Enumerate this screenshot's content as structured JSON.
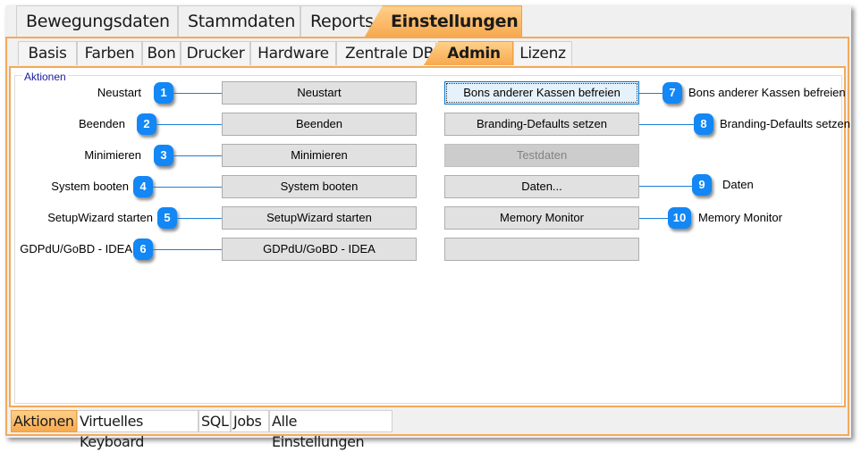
{
  "top_tabs": [
    {
      "label": "Bewegungsdaten",
      "active": false
    },
    {
      "label": "Stammdaten",
      "active": false
    },
    {
      "label": "Reports",
      "active": false
    },
    {
      "label": "Einstellungen",
      "active": true
    }
  ],
  "sub_tabs": [
    {
      "label": "Basis",
      "active": false
    },
    {
      "label": "Farben",
      "active": false
    },
    {
      "label": "Bon",
      "active": false
    },
    {
      "label": "Drucker",
      "active": false
    },
    {
      "label": "Hardware",
      "active": false
    },
    {
      "label": "Zentrale DB",
      "active": false
    },
    {
      "label": "Admin",
      "active": true
    },
    {
      "label": "Lizenz",
      "active": false
    }
  ],
  "group": {
    "title": "Aktionen"
  },
  "left_buttons": [
    {
      "label": "Neustart",
      "callout": "1",
      "callout_label": "Neustart"
    },
    {
      "label": "Beenden",
      "callout": "2",
      "callout_label": "Beenden"
    },
    {
      "label": "Minimieren",
      "callout": "3",
      "callout_label": "Minimieren"
    },
    {
      "label": "System booten",
      "callout": "4",
      "callout_label": "System booten"
    },
    {
      "label": "SetupWizard starten",
      "callout": "5",
      "callout_label": "SetupWizard starten"
    },
    {
      "label": "GDPdU/GoBD - IDEA",
      "callout": "6",
      "callout_label": "GDPdU/GoBD - IDEA"
    }
  ],
  "right_buttons": [
    {
      "label": "Bons anderer Kassen befreien",
      "callout": "7",
      "callout_label": "Bons anderer Kassen befreien",
      "state": "focused"
    },
    {
      "label": "Branding-Defaults setzen",
      "callout": "8",
      "callout_label": "Branding-Defaults setzen",
      "state": "normal"
    },
    {
      "label": "Testdaten",
      "callout": null,
      "callout_label": null,
      "state": "disabled"
    },
    {
      "label": "Daten...",
      "callout": "9",
      "callout_label": "Daten",
      "state": "normal"
    },
    {
      "label": "Memory Monitor",
      "callout": "10",
      "callout_label": "Memory Monitor",
      "state": "normal"
    },
    {
      "label": "",
      "callout": null,
      "callout_label": null,
      "state": "normal"
    }
  ],
  "bottom_tabs": [
    {
      "label": "Aktionen",
      "active": true
    },
    {
      "label": "Virtuelles Keyboard",
      "active": false
    },
    {
      "label": "SQL",
      "active": false
    },
    {
      "label": "Jobs",
      "active": false
    },
    {
      "label": "Alle Einstellungen",
      "active": false
    }
  ],
  "colors": {
    "accent": "#f7a94e",
    "callout": "#1287f5",
    "group_title": "#1a1aa0"
  }
}
